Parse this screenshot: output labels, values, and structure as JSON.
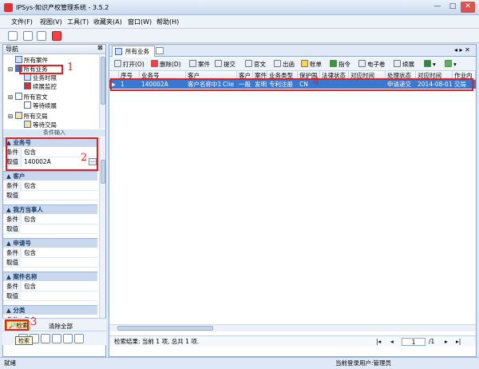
{
  "window": {
    "title": "IPSys-知识产权管理系统 - 3.5.2"
  },
  "menu": [
    "文件(F)",
    "视图(V)",
    "工具(T)",
    "收藏夹(A)",
    "窗口(W)",
    "帮助(H)"
  ],
  "nav": {
    "title": "导航",
    "items": [
      "所有案件",
      "所有业务",
      "业务时限",
      "续展监控",
      "所有官文",
      "等待续展",
      "所有交局",
      "等待交局"
    ],
    "cond_title": "条件输入"
  },
  "conditions": [
    {
      "name": "业务号",
      "cond_label": "条件",
      "cond": "包含",
      "val_label": "取值",
      "val": "140002A",
      "more": "..."
    },
    {
      "name": "客户",
      "cond_label": "条件",
      "cond": "包含",
      "val_label": "取值",
      "val": ""
    },
    {
      "name": "我方当事人",
      "cond_label": "条件",
      "cond": "包含",
      "val_label": "取值",
      "val": ""
    },
    {
      "name": "申请号",
      "cond_label": "条件",
      "cond": "包含",
      "val_label": "取值",
      "val": ""
    },
    {
      "name": "案件名称",
      "cond_label": "条件",
      "cond": "包含",
      "val_label": "取值",
      "val": ""
    },
    {
      "name": "分类",
      "cond_label": "条件",
      "cond": "包含",
      "val_label": "",
      "val": ""
    }
  ],
  "bottom": {
    "search": "检索",
    "clear": "清除全部",
    "tooltip": "检索"
  },
  "tab": {
    "label": "所有业务"
  },
  "toolbar": [
    "打开(O)",
    "删除(D)",
    "案件",
    "提交",
    "官文",
    "出函",
    "账单",
    "指令",
    "电子卷",
    "续展"
  ],
  "grid": {
    "columns": [
      "序号",
      "业务号",
      "客户",
      "客户",
      "案件",
      "业务类型",
      "保护国",
      "法律状态",
      "对应时间",
      "处理状态",
      "对应时间",
      "作业内"
    ],
    "rows": [
      [
        "1",
        "140002A",
        "客户名称中1",
        "Clie",
        "一般",
        "发明",
        "专利注册",
        "CN",
        "",
        "申请递交",
        "2014-08-01",
        "交局"
      ]
    ]
  },
  "grid_status": "检索结果: 当前 1 项, 总共 1 项.",
  "pager": {
    "page": "1",
    "total": "/1"
  },
  "status": {
    "left": "就绪",
    "user": "当前登录用户:管理员"
  },
  "annotations": [
    "1",
    "2",
    "3",
    "4"
  ]
}
